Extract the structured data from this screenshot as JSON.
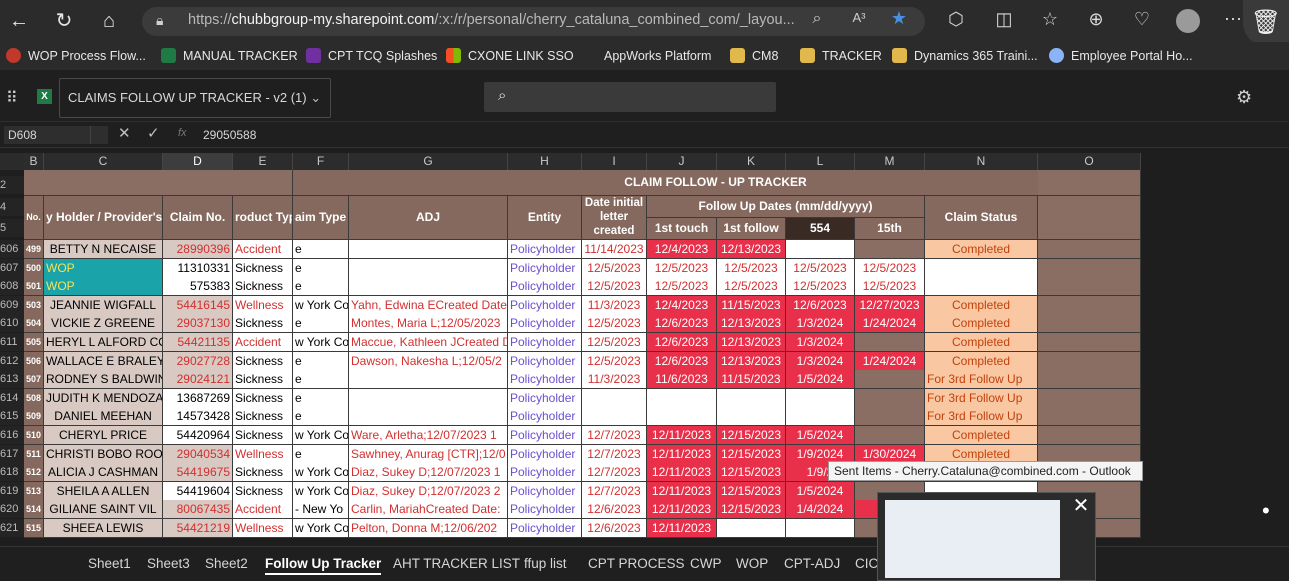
{
  "browser": {
    "url_prefix": "https://",
    "url_host": "chubbgroup-my.sharepoint.com",
    "url_path": "/:x:/r/personal/cherry_cataluna_combined_com/_layou...",
    "read_aloud": "A³"
  },
  "bookmarks": [
    {
      "label": "WOP Process Flow...",
      "color": "#c0392b"
    },
    {
      "label": "MANUAL TRACKER",
      "color": "#1f7a46"
    },
    {
      "label": "CPT TCQ Splashes",
      "color": "#7030a0"
    },
    {
      "label": "CXONE LINK SSO",
      "color": "#f25022"
    },
    {
      "label": "AppWorks Platform",
      "color": "#2b2b2b"
    },
    {
      "label": "CM8",
      "color": "#e0b84c"
    },
    {
      "label": "TRACKER",
      "color": "#e0b84c"
    },
    {
      "label": "Dynamics 365 Traini...",
      "color": "#e0b84c"
    },
    {
      "label": "Employee Portal Ho...",
      "color": "#8ab4f8"
    }
  ],
  "excel": {
    "file_title": "CLAIMS FOLLOW UP TRACKER - v2 (1)",
    "name_box": "D608",
    "formula_value": "29050588",
    "fx": "fx"
  },
  "columns": [
    "B",
    "C",
    "D",
    "E",
    "F",
    "G",
    "H",
    "I",
    "J",
    "K",
    "L",
    "M",
    "N",
    "O"
  ],
  "header": {
    "title": "CLAIM   FOLLOW - UP   TRACKER",
    "no": "No.",
    "holder": "y Holder / Provider's N",
    "claim_no": "Claim No.",
    "product": "roduct Typ",
    "claim_type": "aim Type",
    "adj": "ADJ",
    "entity": "Entity",
    "date_initial": "Date initial letter created",
    "follow_up_dates": "Follow Up Dates (mm/dd/yyyy)",
    "first_touch": "1st touch",
    "first_follow": "1st follow",
    "col_l": "554",
    "col_m": "15th",
    "status": "Claim Status"
  },
  "header_rows": [
    "2",
    "4",
    "5"
  ],
  "rows": [
    {
      "rn": "606",
      "no": "499",
      "name": "BETTY N NECAISE",
      "claim": "28990396",
      "claim_red": true,
      "prod": "Accident",
      "ctype": "e",
      "adj": "",
      "entity": "Policyholder",
      "d0": "11/14/2023",
      "j": "12/4/2023",
      "k": "12/13/2023",
      "l": "",
      "m": "",
      "status": "Completed",
      "style": "A"
    },
    {
      "rn": "607",
      "no": "500",
      "name": "WOP",
      "claim": "11310331",
      "claim_red": false,
      "prod": "Sickness",
      "ctype": "e",
      "adj": "",
      "entity": "Policyholder",
      "d0": "12/5/2023",
      "j": "12/5/2023",
      "k": "12/5/2023",
      "l": "12/5/2023",
      "m": "12/5/2023",
      "status": "",
      "style": "W"
    },
    {
      "rn": "608",
      "no": "501",
      "name": "WOP",
      "claim": "575383",
      "claim_red": false,
      "prod": "Sickness",
      "ctype": "e",
      "adj": "",
      "entity": "Policyholder",
      "d0": "12/5/2023",
      "j": "12/5/2023",
      "k": "12/5/2023",
      "l": "12/5/2023",
      "m": "12/5/2023",
      "status": "",
      "style": "W"
    },
    {
      "rn": "609",
      "no": "503",
      "name": "JEANNIE WIGFALL",
      "claim": "54416145",
      "claim_red": true,
      "prod": "Wellness",
      "ctype": "w York Co",
      "adj": "Yahn, Edwina ECreated Date",
      "entity": "Policyholder",
      "d0": "11/3/2023",
      "j": "12/4/2023",
      "k": "11/15/2023",
      "l": "12/6/2023",
      "m": "12/27/2023",
      "status": "Completed",
      "style": "A"
    },
    {
      "rn": "610",
      "no": "504",
      "name": "VICKIE Z GREENE",
      "claim": "29037130",
      "claim_red": true,
      "prod": "Sickness",
      "ctype": "e",
      "adj": "Montes, Maria L;12/05/2023",
      "entity": "Policyholder",
      "d0": "12/5/2023",
      "j": "12/6/2023",
      "k": "12/13/2023",
      "l": "1/3/2024",
      "m": "1/24/2024",
      "status": "Completed",
      "style": "A"
    },
    {
      "rn": "611",
      "no": "505",
      "name": "HERYL L ALFORD COAR",
      "claim": "54421135",
      "claim_red": true,
      "prod": "Accident",
      "ctype": "w York Co",
      "adj": "Maccue, Kathleen JCreated D",
      "entity": "Policyholder",
      "d0": "12/5/2023",
      "j": "12/6/2023",
      "k": "12/13/2023",
      "l": "1/3/2024",
      "m": "",
      "status": "Completed",
      "style": "A"
    },
    {
      "rn": "612",
      "no": "506",
      "name": "WALLACE E  BRALEY",
      "claim": "29027728",
      "claim_red": true,
      "prod": "Sickness",
      "ctype": "e",
      "adj": "Dawson, Nakesha L;12/05/2",
      "entity": "Policyholder",
      "d0": "12/5/2023",
      "j": "12/6/2023",
      "k": "12/13/2023",
      "l": "1/3/2024",
      "m": "1/24/2024",
      "status": "Completed",
      "style": "A"
    },
    {
      "rn": "613",
      "no": "507",
      "name": "RODNEY S BALDWIN",
      "claim": "29024121",
      "claim_red": true,
      "prod": "Sickness",
      "ctype": "e",
      "adj": "",
      "entity": "Policyholder",
      "d0": "11/3/2023",
      "j": "11/6/2023",
      "k": "11/15/2023",
      "l": "1/5/2024",
      "m": "",
      "status": "For 3rd Follow Up",
      "style": "A"
    },
    {
      "rn": "614",
      "no": "508",
      "name": "JUDITH K MENDOZA",
      "claim": "13687269",
      "claim_red": false,
      "prod": "Sickness",
      "ctype": "e",
      "adj": "",
      "entity": "Policyholder",
      "d0": "",
      "j": "",
      "k": "",
      "l": "",
      "m": "",
      "status": "For 3rd Follow Up",
      "style": "E"
    },
    {
      "rn": "615",
      "no": "509",
      "name": "DANIEL MEEHAN",
      "claim": "14573428",
      "claim_red": false,
      "prod": "Sickness",
      "ctype": "e",
      "adj": "",
      "entity": "Policyholder",
      "d0": "",
      "j": "",
      "k": "",
      "l": "",
      "m": "",
      "status": "For 3rd Follow Up",
      "style": "E"
    },
    {
      "rn": "616",
      "no": "510",
      "name": "CHERYL PRICE",
      "claim": "54420964",
      "claim_red": false,
      "prod": "Sickness",
      "ctype": "w York Co",
      "adj": "Ware, Arletha;12/07/2023 1",
      "entity": "Policyholder",
      "d0": "12/7/2023",
      "j": "12/11/2023",
      "k": "12/15/2023",
      "l": "1/5/2024",
      "m": "",
      "status": "Completed",
      "style": "A"
    },
    {
      "rn": "617",
      "no": "511",
      "name": "CHRISTI BOBO ROOKE",
      "claim": "29040534",
      "claim_red": true,
      "prod": "Wellness",
      "ctype": "e",
      "adj": "Sawhney, Anurag [CTR];12/0",
      "entity": "Policyholder",
      "d0": "12/7/2023",
      "j": "12/11/2023",
      "k": "12/15/2023",
      "l": "1/9/2024",
      "m": "1/30/2024",
      "status": "Completed",
      "style": "A"
    },
    {
      "rn": "618",
      "no": "512",
      "name": "ALICIA J CASHMAN",
      "claim": "54419675",
      "claim_red": true,
      "prod": "Sickness",
      "ctype": "w York Co",
      "adj": "Diaz, Sukey D;12/07/2023 1",
      "entity": "Policyholder",
      "d0": "12/7/2023",
      "j": "12/11/2023",
      "k": "12/15/2023",
      "l": "1/9/2",
      "m": "",
      "status": "",
      "style": "A"
    },
    {
      "rn": "619",
      "no": "513",
      "name": "SHEILA A ALLEN",
      "claim": "54419604",
      "claim_red": false,
      "prod": "Sickness",
      "ctype": "w York Co",
      "adj": "Diaz, Sukey D;12/07/2023 2",
      "entity": "Policyholder",
      "d0": "12/7/2023",
      "j": "12/11/2023",
      "k": "12/15/2023",
      "l": "1/5/2024",
      "m": "",
      "status": "",
      "style": "A"
    },
    {
      "rn": "620",
      "no": "514",
      "name": "GILIANE  SAINT VIL",
      "claim": "80067435",
      "claim_red": true,
      "prod": "Accident",
      "ctype": "- New Yo",
      "adj": "Carlin, MariahCreated Date:",
      "entity": "Policyholder",
      "d0": "12/6/2023",
      "j": "12/11/2023",
      "k": "12/15/2023",
      "l": "1/4/2024",
      "m": "1/",
      "status": "",
      "style": "A"
    },
    {
      "rn": "621",
      "no": "515",
      "name": "SHEEA LEWIS",
      "claim": "54421219",
      "claim_red": true,
      "prod": "Wellness",
      "ctype": "w York Co",
      "adj": "Pelton, Donna M;12/06/202",
      "entity": "Policyholder",
      "d0": "12/6/2023",
      "j": "12/11/2023",
      "k": "",
      "l": "",
      "m": "",
      "status": "",
      "style": "A"
    }
  ],
  "tabs": [
    "Sheet1",
    "Sheet3",
    "Sheet2",
    "Follow Up Tracker",
    "AHT TRACKER LIST",
    "ffup list",
    "CPT PROCESS",
    "CWP",
    "WOP",
    "CPT-ADJ",
    "CICA"
  ],
  "active_tab": "Follow Up Tracker",
  "tooltip": "Sent Items - Cherry.Cataluna@combined.com - Outlook"
}
